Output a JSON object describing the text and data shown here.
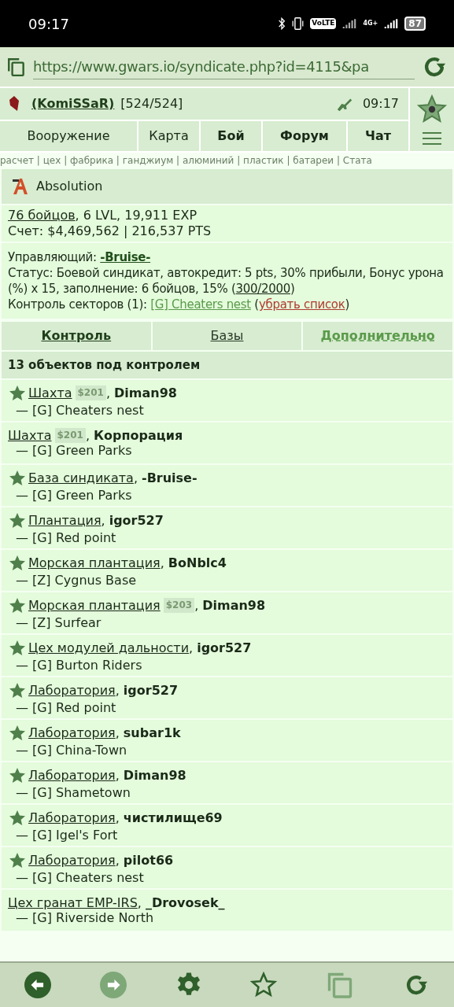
{
  "status_bar": {
    "time": "09:17",
    "volte": "VoLTE",
    "network": "4G+",
    "battery": "87"
  },
  "address_bar": {
    "url": "https://www.gwars.io/syndicate.php?id=4115&pa"
  },
  "header": {
    "player": "(KomiSSaR)",
    "hp": "[524/524]",
    "time": "09:17"
  },
  "nav": [
    {
      "label": "Вооружение",
      "bold": false
    },
    {
      "label": "Карта",
      "bold": false
    },
    {
      "label": "Бой",
      "bold": true
    },
    {
      "label": "Форум",
      "bold": true
    },
    {
      "label": "Чат",
      "bold": true
    }
  ],
  "subnav": "расчет | цех | фабрика | ганджиум | алюминий | пластик | батареи | Стата",
  "syndicate": {
    "name": "Absolution",
    "fighters": "76 бойцов",
    "stats": ", 6 LVL, 19,911 EXP",
    "account": "Счет: $4,469,562 | 216,537 PTS"
  },
  "manager": {
    "label": "Управляющий: ",
    "name": "-Bruise-",
    "status": "Статус: Боевой синдикат, автокредит: 5 pts, 30% прибыли, Бонус урона (%) x 15, заполнение: 6 бойцов, 15% (",
    "fill_link": "300/2000",
    "status_end": ")",
    "sectors_label": "Контроль секторов (1): ",
    "sector_link": "[G] Cheaters nest",
    "open": " (",
    "remove_link": "убрать список",
    "close": ")"
  },
  "tabs": [
    {
      "label": "Контроль",
      "selected": true,
      "kind": "plain"
    },
    {
      "label": "Базы",
      "selected": false,
      "kind": "plain"
    },
    {
      "label": "Дополнительно",
      "selected": false,
      "kind": "dashed"
    }
  ],
  "objects_heading": "13 объектов под контролем",
  "separator": ",",
  "objects": [
    {
      "starred": true,
      "name": "Шахта",
      "price": "$201",
      "owner": "Diman98",
      "sector": "— [G] Cheaters nest"
    },
    {
      "starred": false,
      "name": "Шахта",
      "price": "$201",
      "owner": "Корпорация",
      "sector": "— [G] Green Parks"
    },
    {
      "starred": true,
      "name": "База синдиката",
      "owner": "-Bruise-",
      "sector": "— [G] Green Parks"
    },
    {
      "starred": true,
      "name": "Плантация",
      "owner": "igor527",
      "sector": "— [G] Red point"
    },
    {
      "starred": true,
      "name": "Морская плантация",
      "owner": "BoNblc4",
      "sector": "— [Z] Cygnus Base"
    },
    {
      "starred": true,
      "name": "Морская плантация",
      "price": "$203",
      "owner": "Diman98",
      "sector": "— [Z] Surfear"
    },
    {
      "starred": true,
      "name": "Цех модулей дальности",
      "owner": "igor527",
      "sector": "— [G] Burton Riders"
    },
    {
      "starred": true,
      "name": "Лаборатория",
      "owner": "igor527",
      "sector": "— [G] Red point"
    },
    {
      "starred": true,
      "name": "Лаборатория",
      "owner": "subar1k",
      "sector": "— [G] China-Town"
    },
    {
      "starred": true,
      "name": "Лаборатория",
      "owner": "Diman98",
      "sector": "— [G] Shametown"
    },
    {
      "starred": true,
      "name": "Лаборатория",
      "owner": "чистилище69",
      "sector": "— [G] Igel's Fort"
    },
    {
      "starred": true,
      "name": "Лаборатория",
      "owner": "pilot66",
      "sector": "— [G] Cheaters nest"
    },
    {
      "starred": false,
      "name": "Цех гранат EMP-IRS",
      "owner": "_Drovosek_",
      "sector": "— [G] Riverside North"
    }
  ]
}
